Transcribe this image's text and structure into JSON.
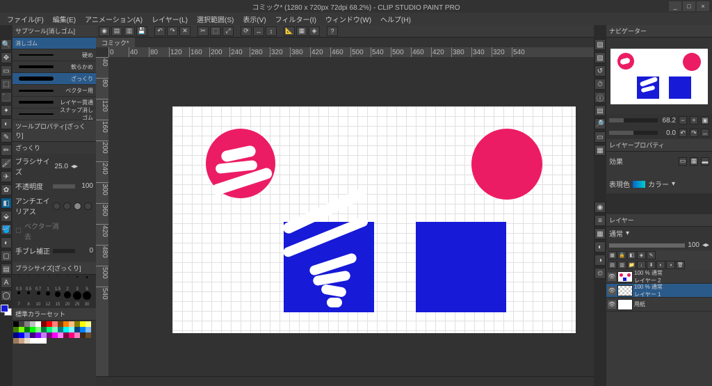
{
  "titlebar": {
    "title": "コミック* (1280 x 720px 72dpi 68.2%) - CLIP STUDIO PAINT PRO"
  },
  "menu": {
    "items": [
      "ファイル(F)",
      "編集(E)",
      "アニメーション(A)",
      "レイヤー(L)",
      "選択範囲(S)",
      "表示(V)",
      "フィルター(I)",
      "ウィンドウ(W)",
      "ヘルプ(H)"
    ]
  },
  "doc_tab": "コミック*",
  "subtool": {
    "tab": "サブツール[消しゴム]",
    "group": "消しゴム",
    "items": [
      {
        "label": "硬め"
      },
      {
        "label": "軟らかめ"
      },
      {
        "label": "ざっくり"
      },
      {
        "label": "ベクター用"
      },
      {
        "label": "レイヤー貫通"
      },
      {
        "label": "スナップ消しゴム"
      }
    ]
  },
  "tool_property": {
    "tab": "ツールプロパティ[ざっくり]",
    "header": "ざっくり",
    "brush_size_label": "ブラシサイズ",
    "brush_size_value": "25.0",
    "opacity_label": "不透明度",
    "opacity_value": "100",
    "antialias_label": "アンチエイリアス",
    "vector_erase_label": "ベクター消去",
    "stabilization_label": "手ブレ補正",
    "stabilization_value": "0"
  },
  "brush_size_panel": {
    "tab": "ブラシサイズ[ざっくり]",
    "sizes": [
      0.3,
      0.5,
      0.7,
      1,
      1.5,
      2,
      3,
      5,
      7,
      8,
      10,
      12,
      15,
      20,
      25,
      30
    ]
  },
  "color_set": {
    "tab": "標準カラーセット",
    "colors": [
      "#000000",
      "#404040",
      "#808080",
      "#c0c0c0",
      "#ffffff",
      "#800000",
      "#ff0000",
      "#ff8080",
      "#804000",
      "#ff8000",
      "#ffbf80",
      "#808000",
      "#ffff00",
      "#ffff80",
      "#408000",
      "#80ff00",
      "#008000",
      "#00ff00",
      "#80ff80",
      "#008040",
      "#00ff80",
      "#80ffbf",
      "#008080",
      "#00ffff",
      "#80ffff",
      "#004080",
      "#0080ff",
      "#80bfff",
      "#000080",
      "#0000ff",
      "#8080ff",
      "#400080",
      "#8000ff",
      "#bf80ff",
      "#800080",
      "#ff00ff",
      "#ff80ff",
      "#800040",
      "#ff0080",
      "#ff80bf",
      "#3a2a1a",
      "#6a4a2a",
      "#9a7a5a",
      "#caa68a",
      "#eaddca",
      "#ffffff",
      "#ffffff",
      "#ffffff"
    ]
  },
  "navigator": {
    "tab": "ナビゲーター",
    "zoom_value": "68.2",
    "rotation_value": "0.0"
  },
  "layer_property": {
    "tab": "レイヤープロパティ",
    "effect_label": "効果",
    "expression_color_label": "表現色",
    "color_dropdown": "カラー"
  },
  "layer_panel": {
    "tab": "レイヤー",
    "blend_mode": "通常",
    "opacity_value": "100",
    "layers": [
      {
        "name": "レイヤー 2",
        "opacity": "100 % 通常"
      },
      {
        "name": "レイヤー 1",
        "opacity": "100 % 通常"
      },
      {
        "name": "用紙",
        "opacity": ""
      }
    ]
  },
  "ruler_h": [
    "0",
    "40",
    "80",
    "120",
    "160",
    "200",
    "240",
    "280",
    "320",
    "380",
    "420",
    "460",
    "500",
    "540",
    "500",
    "460",
    "420",
    "380",
    "340",
    "320",
    "540"
  ],
  "ruler_v": [
    "40",
    "80",
    "120",
    "160",
    "200",
    "240",
    "300",
    "360",
    "420",
    "480",
    "500",
    "540"
  ]
}
